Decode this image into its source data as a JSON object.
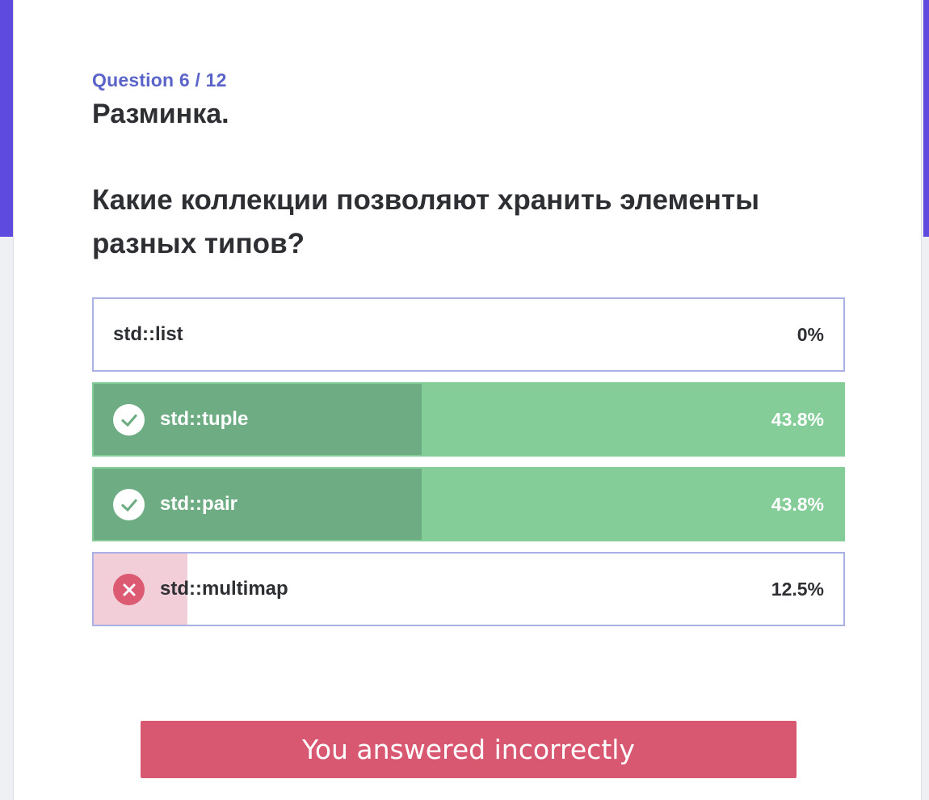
{
  "question": {
    "counter": "Question 6 / 12",
    "title": "Разминка.",
    "text": "Какие коллекции позволяют хранить элементы разных типов?"
  },
  "options": [
    {
      "label": "std::list",
      "percent_label": "0%",
      "percent": 0,
      "status": "none"
    },
    {
      "label": "std::tuple",
      "percent_label": "43.8%",
      "percent": 43.8,
      "status": "correct",
      "icon": "check-circle-icon"
    },
    {
      "label": "std::pair",
      "percent_label": "43.8%",
      "percent": 43.8,
      "status": "correct",
      "icon": "check-circle-icon"
    },
    {
      "label": "std::multimap",
      "percent_label": "12.5%",
      "percent": 12.5,
      "status": "wrong",
      "icon": "x-circle-icon"
    }
  ],
  "result": {
    "text": "You answered incorrectly",
    "color": "#d95871"
  },
  "colors": {
    "accent": "#5f4ae0",
    "question_counter": "#5a64c8",
    "correct_bar": "#84cc98",
    "correct_fill": "#6ead84",
    "wrong_fill": "#f2cfd8",
    "wrong_icon": "#dc5a72"
  }
}
